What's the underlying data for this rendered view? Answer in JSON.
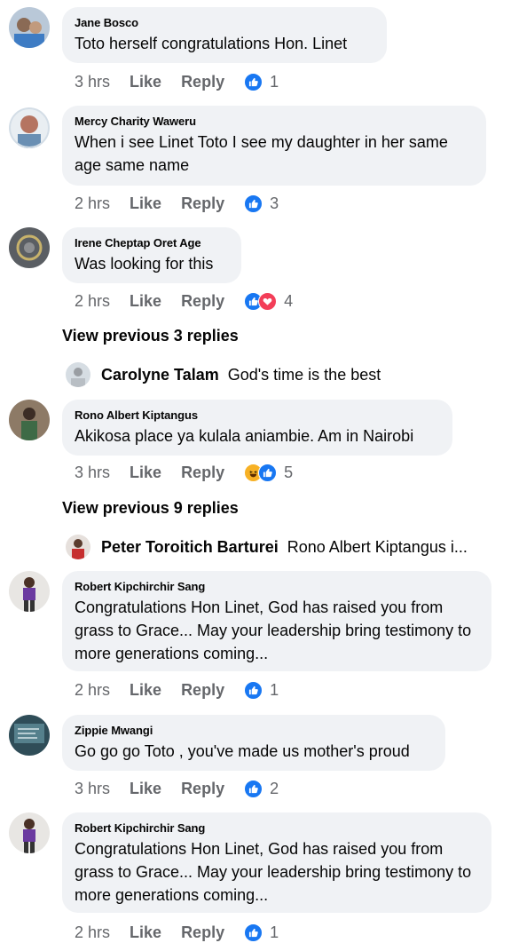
{
  "comments": [
    {
      "author": "Jane Bosco",
      "text": "Toto herself congratulations Hon. Linet",
      "time": "3 hrs",
      "like": "Like",
      "reply": "Reply",
      "reactions": [
        "like"
      ],
      "count": "1"
    },
    {
      "author": "Mercy Charity Waweru",
      "text": "When i see Linet Toto I see my daughter in her same age same name",
      "time": "2 hrs",
      "like": "Like",
      "reply": "Reply",
      "reactions": [
        "like"
      ],
      "count": "3"
    },
    {
      "author": "Irene Cheptap Oret Age",
      "text": "Was looking for this",
      "time": "2 hrs",
      "like": "Like",
      "reply": "Reply",
      "reactions": [
        "like",
        "love"
      ],
      "count": "4"
    },
    {
      "author": "Rono Albert Kiptangus",
      "text": "Akikosa place ya kulala aniambie. Am in Nairobi",
      "time": "3 hrs",
      "like": "Like",
      "reply": "Reply",
      "reactions": [
        "haha",
        "like"
      ],
      "count": "5"
    },
    {
      "author": "Robert Kipchirchir Sang",
      "text": "Congratulations Hon Linet,  God has raised you from grass to Grace... May your leadership bring testimony to more generations coming...",
      "time": "2 hrs",
      "like": "Like",
      "reply": "Reply",
      "reactions": [
        "like"
      ],
      "count": "1"
    },
    {
      "author": "Zippie Mwangi",
      "text": "Go go go Toto , you've made us mother's proud",
      "time": "3 hrs",
      "like": "Like",
      "reply": "Reply",
      "reactions": [
        "like"
      ],
      "count": "2"
    },
    {
      "author": "Robert Kipchirchir Sang",
      "text": "Congratulations Hon Linet,  God has raised you from grass to Grace... May your leadership bring testimony to more generations coming...",
      "time": "2 hrs",
      "like": "Like",
      "reply": "Reply",
      "reactions": [
        "like"
      ],
      "count": "1"
    }
  ],
  "view_previous": [
    "View previous 3 replies",
    "View previous 9 replies"
  ],
  "reply_previews": [
    {
      "name": "Carolyne Talam",
      "text": "God's time is the best"
    },
    {
      "name": "Peter Toroitich Barturei",
      "text": "Rono Albert Kiptangus i..."
    }
  ],
  "colors": {
    "bubble": "#f0f2f5",
    "meta": "#65676b",
    "like": "#1877f2",
    "love": "#f33e58",
    "haha": "#f7b125"
  }
}
